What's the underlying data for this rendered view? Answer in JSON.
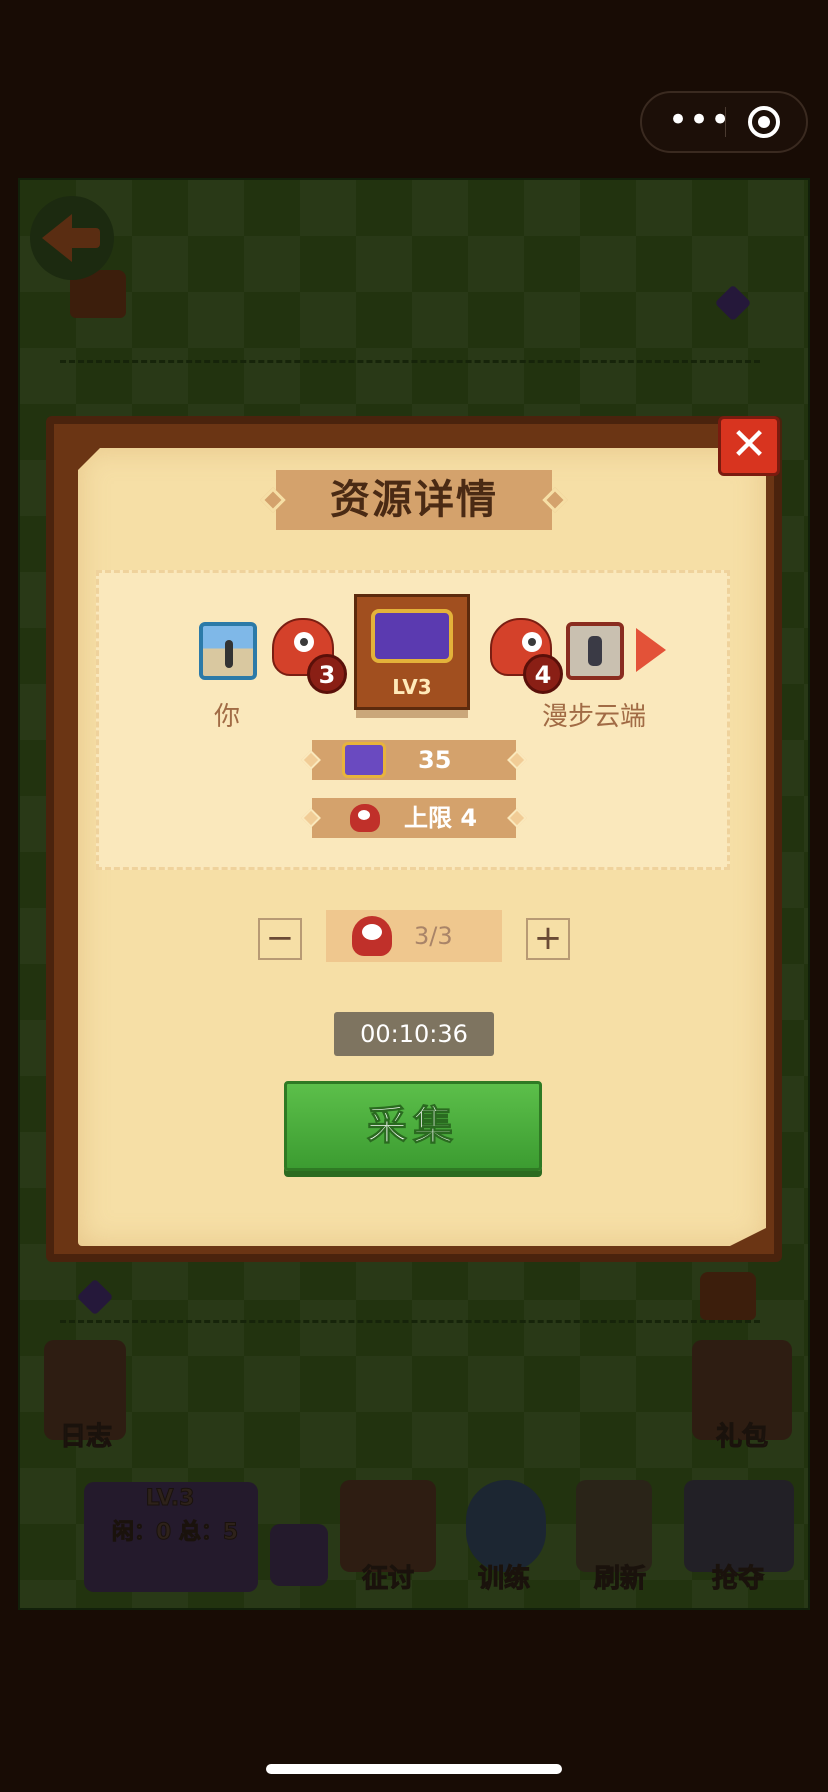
{
  "miniprogram_capsule": {
    "more_icon": "more-dots-icon",
    "close_icon": "target-circle-icon"
  },
  "game": {
    "back_icon": "back-arrow-icon",
    "toolbar": {
      "log_label": "日志",
      "gift_label": "礼包",
      "base_level": "LV.3",
      "base_status": "闲：0 总：5",
      "expedition_label": "征讨",
      "train_label": "训练",
      "refresh_label": "刷新",
      "raid_label": "抢夺"
    }
  },
  "dialog": {
    "title": "资源详情",
    "close_icon": "close-x-icon",
    "you": {
      "name": "你",
      "monster_count": "3"
    },
    "opponent": {
      "name": "漫步云端",
      "monster_count": "4"
    },
    "resource": {
      "level": "LV3",
      "amount": "35",
      "limit_label": "上限 4"
    },
    "stepper": {
      "minus": "−",
      "plus": "+",
      "value": "3/3"
    },
    "timer": "00:10:36",
    "collect_button": "采集"
  },
  "colors": {
    "accent_green": "#4aae3a",
    "close_red": "#d8341f",
    "paper": "#f6dfa6"
  }
}
